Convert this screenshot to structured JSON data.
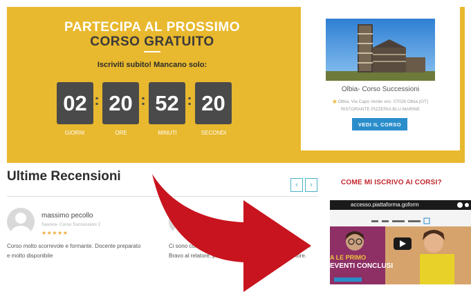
{
  "hero": {
    "title_line1": "PARTECIPA AL PROSSIMO",
    "title_line2": "CORSO GRATUITO",
    "subtitle": "Iscriviti subito! Mancano solo:",
    "countdown": [
      {
        "value": "02",
        "label": "GIORNI"
      },
      {
        "value": "20",
        "label": "ORE"
      },
      {
        "value": "52",
        "label": "MINUTI"
      },
      {
        "value": "20",
        "label": "SECONDI"
      }
    ],
    "separator": ":"
  },
  "course_card": {
    "title": "Olbia- Corso Successioni",
    "address": "Olbia, Via Capo Verde snc- 07026 Olbia (OT)",
    "venue": "RISTORANTE PIZZERIA BLU MARINE",
    "button_label": "VEDI IL CORSO"
  },
  "reviews": {
    "title": "Ultime Recensioni",
    "prev_label": "‹",
    "next_label": "›",
    "items": [
      {
        "name": "massimo pecollo",
        "course": "Savona- Corso Successioni 2",
        "stars": "★★★★★",
        "text_line1": "Corso molto scorrevole e formante. Docente preparato",
        "text_line2": "e molto disponibile"
      },
      {
        "text_line1": "Ci sono corsi",
        "text_line1_end": "meno.",
        "text_line2": "Bravo al relatore, pre",
        "text_line2_end": "tore."
      }
    ]
  },
  "howto": {
    "title": "COME MI ISCRIVO AI CORSI?",
    "video_url_text": "accesso.piattaforma.goform",
    "video_overlay_line1": "A LE PRIMO",
    "video_overlay_line2": "EVENTI CONCLUSI"
  },
  "colors": {
    "hero_bg": "#e8b82e",
    "countdown_box": "#4a4a4a",
    "button": "#2a8ecb",
    "accent_red": "#c1272d",
    "stars": "#f0a93a"
  }
}
